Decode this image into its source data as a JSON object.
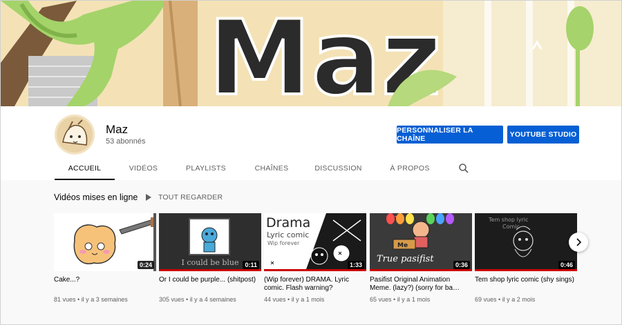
{
  "banner": {
    "text": "Maz"
  },
  "channel": {
    "name": "Maz",
    "subscribers": "53 abonnés",
    "customize_label": "PERSONNALISER LA CHAÎNE",
    "studio_label": "YOUTUBE STUDIO"
  },
  "tabs": [
    {
      "label": "ACCUEIL",
      "active": true
    },
    {
      "label": "VIDÉOS",
      "active": false
    },
    {
      "label": "PLAYLISTS",
      "active": false
    },
    {
      "label": "CHAÎNES",
      "active": false
    },
    {
      "label": "DISCUSSION",
      "active": false
    },
    {
      "label": "À PROPOS",
      "active": false
    }
  ],
  "shelf": {
    "title": "Vidéos mises en ligne",
    "play_all": "TOUT REGARDER"
  },
  "thumb_text": {
    "v2": "I could be blue",
    "v3_title": "Drama",
    "v3_sub": "Lyric comic",
    "v3_sub2": "Wip forever",
    "v4_sign": "True pasifist",
    "v4_me": "Me",
    "v5_title": "Tem shop lyric",
    "v5_sub": "Comic"
  },
  "videos": [
    {
      "title": "Cake...?",
      "views": "81 vues",
      "age": "il y a 3 semaines",
      "duration": "0:24"
    },
    {
      "title": "Or I could be purple... (shitpost)",
      "views": "305 vues",
      "age": "il y a 4 semaines",
      "duration": "0:11"
    },
    {
      "title": "(Wip forever) DRAMA. Lyric comic. Flash warning?",
      "views": "44 vues",
      "age": "il y a 1 mois",
      "duration": "1:33"
    },
    {
      "title": "Pasifist Original Animation Meme. (lazy?) (sorry for ba…",
      "views": "65 vues",
      "age": "il y a 1 mois",
      "duration": "0:36"
    },
    {
      "title": "Tem shop lyric comic (shy sings)",
      "views": "69 vues",
      "age": "il y a 2 mois",
      "duration": "0:46"
    }
  ],
  "colors": {
    "accent": "#065fd4",
    "progress": "#cc0000"
  }
}
